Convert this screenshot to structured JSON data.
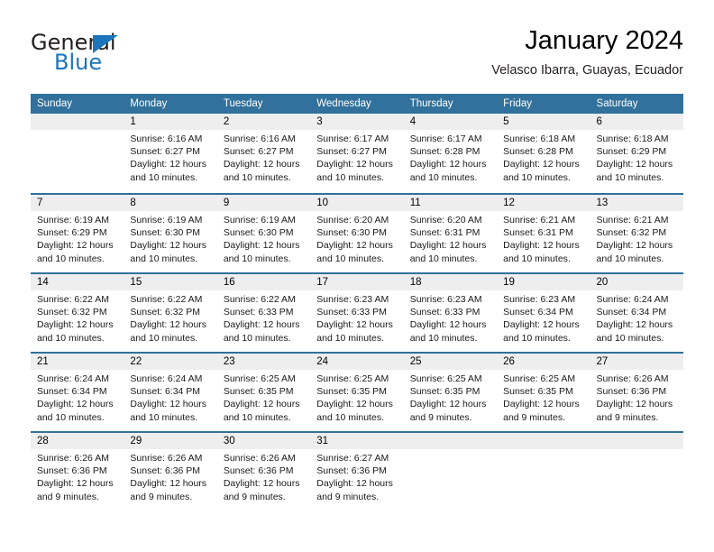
{
  "brand": {
    "name_top": "General",
    "name_bottom": "Blue",
    "color_primary": "#1b75bb",
    "color_text": "#231f20",
    "triangle_icon": "triangle-icon"
  },
  "header": {
    "title": "January 2024",
    "subtitle": "Velasco Ibarra, Guayas, Ecuador"
  },
  "colors": {
    "header_band": "#31719b",
    "day_number_band": "#eeeeee",
    "grid_line": "#31719b"
  },
  "calendar": {
    "day_headers": [
      "Sunday",
      "Monday",
      "Tuesday",
      "Wednesday",
      "Thursday",
      "Friday",
      "Saturday"
    ],
    "weeks": [
      [
        {
          "day": "",
          "lines": []
        },
        {
          "day": "1",
          "lines": [
            "Sunrise: 6:16 AM",
            "Sunset: 6:27 PM",
            "Daylight: 12 hours",
            "and 10 minutes."
          ]
        },
        {
          "day": "2",
          "lines": [
            "Sunrise: 6:16 AM",
            "Sunset: 6:27 PM",
            "Daylight: 12 hours",
            "and 10 minutes."
          ]
        },
        {
          "day": "3",
          "lines": [
            "Sunrise: 6:17 AM",
            "Sunset: 6:27 PM",
            "Daylight: 12 hours",
            "and 10 minutes."
          ]
        },
        {
          "day": "4",
          "lines": [
            "Sunrise: 6:17 AM",
            "Sunset: 6:28 PM",
            "Daylight: 12 hours",
            "and 10 minutes."
          ]
        },
        {
          "day": "5",
          "lines": [
            "Sunrise: 6:18 AM",
            "Sunset: 6:28 PM",
            "Daylight: 12 hours",
            "and 10 minutes."
          ]
        },
        {
          "day": "6",
          "lines": [
            "Sunrise: 6:18 AM",
            "Sunset: 6:29 PM",
            "Daylight: 12 hours",
            "and 10 minutes."
          ]
        }
      ],
      [
        {
          "day": "7",
          "lines": [
            "Sunrise: 6:19 AM",
            "Sunset: 6:29 PM",
            "Daylight: 12 hours",
            "and 10 minutes."
          ]
        },
        {
          "day": "8",
          "lines": [
            "Sunrise: 6:19 AM",
            "Sunset: 6:30 PM",
            "Daylight: 12 hours",
            "and 10 minutes."
          ]
        },
        {
          "day": "9",
          "lines": [
            "Sunrise: 6:19 AM",
            "Sunset: 6:30 PM",
            "Daylight: 12 hours",
            "and 10 minutes."
          ]
        },
        {
          "day": "10",
          "lines": [
            "Sunrise: 6:20 AM",
            "Sunset: 6:30 PM",
            "Daylight: 12 hours",
            "and 10 minutes."
          ]
        },
        {
          "day": "11",
          "lines": [
            "Sunrise: 6:20 AM",
            "Sunset: 6:31 PM",
            "Daylight: 12 hours",
            "and 10 minutes."
          ]
        },
        {
          "day": "12",
          "lines": [
            "Sunrise: 6:21 AM",
            "Sunset: 6:31 PM",
            "Daylight: 12 hours",
            "and 10 minutes."
          ]
        },
        {
          "day": "13",
          "lines": [
            "Sunrise: 6:21 AM",
            "Sunset: 6:32 PM",
            "Daylight: 12 hours",
            "and 10 minutes."
          ]
        }
      ],
      [
        {
          "day": "14",
          "lines": [
            "Sunrise: 6:22 AM",
            "Sunset: 6:32 PM",
            "Daylight: 12 hours",
            "and 10 minutes."
          ]
        },
        {
          "day": "15",
          "lines": [
            "Sunrise: 6:22 AM",
            "Sunset: 6:32 PM",
            "Daylight: 12 hours",
            "and 10 minutes."
          ]
        },
        {
          "day": "16",
          "lines": [
            "Sunrise: 6:22 AM",
            "Sunset: 6:33 PM",
            "Daylight: 12 hours",
            "and 10 minutes."
          ]
        },
        {
          "day": "17",
          "lines": [
            "Sunrise: 6:23 AM",
            "Sunset: 6:33 PM",
            "Daylight: 12 hours",
            "and 10 minutes."
          ]
        },
        {
          "day": "18",
          "lines": [
            "Sunrise: 6:23 AM",
            "Sunset: 6:33 PM",
            "Daylight: 12 hours",
            "and 10 minutes."
          ]
        },
        {
          "day": "19",
          "lines": [
            "Sunrise: 6:23 AM",
            "Sunset: 6:34 PM",
            "Daylight: 12 hours",
            "and 10 minutes."
          ]
        },
        {
          "day": "20",
          "lines": [
            "Sunrise: 6:24 AM",
            "Sunset: 6:34 PM",
            "Daylight: 12 hours",
            "and 10 minutes."
          ]
        }
      ],
      [
        {
          "day": "21",
          "lines": [
            "Sunrise: 6:24 AM",
            "Sunset: 6:34 PM",
            "Daylight: 12 hours",
            "and 10 minutes."
          ]
        },
        {
          "day": "22",
          "lines": [
            "Sunrise: 6:24 AM",
            "Sunset: 6:34 PM",
            "Daylight: 12 hours",
            "and 10 minutes."
          ]
        },
        {
          "day": "23",
          "lines": [
            "Sunrise: 6:25 AM",
            "Sunset: 6:35 PM",
            "Daylight: 12 hours",
            "and 10 minutes."
          ]
        },
        {
          "day": "24",
          "lines": [
            "Sunrise: 6:25 AM",
            "Sunset: 6:35 PM",
            "Daylight: 12 hours",
            "and 10 minutes."
          ]
        },
        {
          "day": "25",
          "lines": [
            "Sunrise: 6:25 AM",
            "Sunset: 6:35 PM",
            "Daylight: 12 hours",
            "and 9 minutes."
          ]
        },
        {
          "day": "26",
          "lines": [
            "Sunrise: 6:25 AM",
            "Sunset: 6:35 PM",
            "Daylight: 12 hours",
            "and 9 minutes."
          ]
        },
        {
          "day": "27",
          "lines": [
            "Sunrise: 6:26 AM",
            "Sunset: 6:36 PM",
            "Daylight: 12 hours",
            "and 9 minutes."
          ]
        }
      ],
      [
        {
          "day": "28",
          "lines": [
            "Sunrise: 6:26 AM",
            "Sunset: 6:36 PM",
            "Daylight: 12 hours",
            "and 9 minutes."
          ]
        },
        {
          "day": "29",
          "lines": [
            "Sunrise: 6:26 AM",
            "Sunset: 6:36 PM",
            "Daylight: 12 hours",
            "and 9 minutes."
          ]
        },
        {
          "day": "30",
          "lines": [
            "Sunrise: 6:26 AM",
            "Sunset: 6:36 PM",
            "Daylight: 12 hours",
            "and 9 minutes."
          ]
        },
        {
          "day": "31",
          "lines": [
            "Sunrise: 6:27 AM",
            "Sunset: 6:36 PM",
            "Daylight: 12 hours",
            "and 9 minutes."
          ]
        },
        {
          "day": "",
          "lines": []
        },
        {
          "day": "",
          "lines": []
        },
        {
          "day": "",
          "lines": []
        }
      ]
    ]
  }
}
